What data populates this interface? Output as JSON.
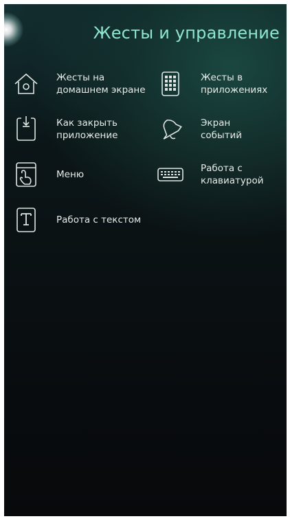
{
  "page": {
    "title": "Жесты и управление"
  },
  "items": [
    {
      "label": "Жесты на домашнем экране",
      "icon": "home-icon"
    },
    {
      "label": "Жесты в приложениях",
      "icon": "app-grid-icon"
    },
    {
      "label": "Как закрыть приложение",
      "icon": "close-app-icon"
    },
    {
      "label": "Экран событий",
      "icon": "bell-icon"
    },
    {
      "label": "Меню",
      "icon": "menu-gesture-icon"
    },
    {
      "label": "Работа с клавиатурой",
      "icon": "keyboard-icon"
    },
    {
      "label": "Работа с текстом",
      "icon": "text-icon"
    }
  ],
  "colors": {
    "title": "#8fe6cf",
    "label": "#e6ece9",
    "icon_stroke": "#dfe6e3",
    "background": "#0b1416"
  }
}
